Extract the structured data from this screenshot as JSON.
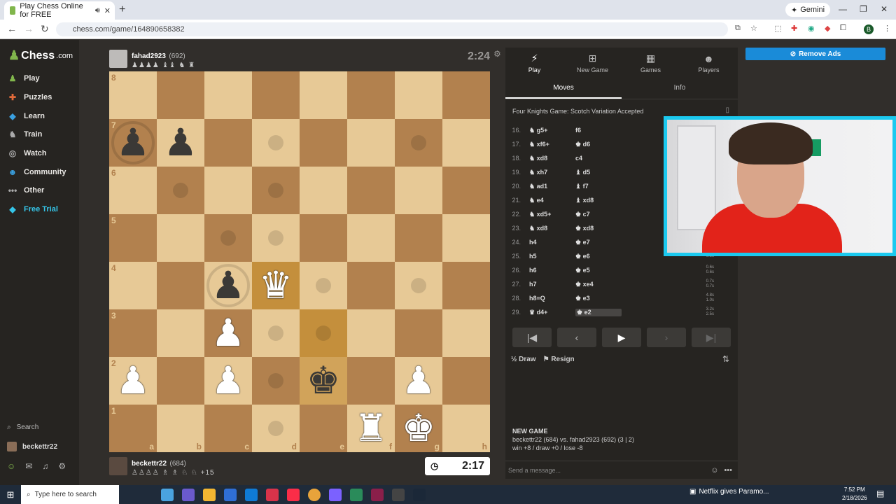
{
  "browser": {
    "tab_title": "Play Chess Online for FREE",
    "url": "chess.com/game/164890658382",
    "gemini_label": "Gemini",
    "profile_letter": "B"
  },
  "sidebar": {
    "logo": "Chess",
    "logo_suffix": ".com",
    "items": [
      {
        "label": "Play",
        "icon": "pawn-icon",
        "color": "#81b64c"
      },
      {
        "label": "Puzzles",
        "icon": "puzzle-icon",
        "color": "#e06a3a"
      },
      {
        "label": "Learn",
        "icon": "learn-icon",
        "color": "#3aa0e0"
      },
      {
        "label": "Train",
        "icon": "train-icon",
        "color": "#aaaaaa"
      },
      {
        "label": "Watch",
        "icon": "binoculars-icon",
        "color": "#aaaaaa"
      },
      {
        "label": "Community",
        "icon": "community-icon",
        "color": "#3aa0e0"
      },
      {
        "label": "Other",
        "icon": "more-icon",
        "color": "#aaaaaa"
      },
      {
        "label": "Free Trial",
        "icon": "diamond-icon",
        "color": "#35c5e8"
      }
    ],
    "search_label": "Search",
    "user_label": "beckettr22"
  },
  "top_player": {
    "name": "fahad2923",
    "rating": "(692)",
    "captured": "♟♟♟♟ ♝♝ ♞ ♜",
    "clock": "2:24"
  },
  "bottom_player": {
    "name": "beckettr22",
    "rating": "(684)",
    "captured": "♙♙♙♙ ♗ ♗ ♘ ♘",
    "advantage": "+15",
    "clock": "2:17"
  },
  "board": {
    "files": [
      "a",
      "b",
      "c",
      "d",
      "e",
      "f",
      "g",
      "h"
    ],
    "ranks": [
      "8",
      "7",
      "6",
      "5",
      "4",
      "3",
      "2",
      "1"
    ]
  },
  "panel": {
    "tabs": [
      {
        "label": "Play",
        "icon": "lightning-icon"
      },
      {
        "label": "New Game",
        "icon": "plus-icon"
      },
      {
        "label": "Games",
        "icon": "grid-icon"
      },
      {
        "label": "Players",
        "icon": "players-icon"
      }
    ],
    "subtabs": [
      "Moves",
      "Info"
    ],
    "opening": "Four Knights Game: Scotch Variation Accepted",
    "moves": [
      {
        "n": "16.",
        "w": "♞ g5+",
        "b": "f6",
        "t": [
          "",
          ""
        ]
      },
      {
        "n": "17.",
        "w": "♞ xf6+",
        "b": "♚ d6",
        "t": [
          "",
          ""
        ]
      },
      {
        "n": "18.",
        "w": "♞ xd8",
        "b": "c4",
        "t": [
          "",
          ""
        ]
      },
      {
        "n": "19.",
        "w": "♞ xh7",
        "b": "♝ d5",
        "t": [
          "",
          ""
        ]
      },
      {
        "n": "20.",
        "w": "♞ ad1",
        "b": "♝ f7",
        "t": [
          "",
          ""
        ]
      },
      {
        "n": "21.",
        "w": "♞ e4",
        "b": "♝ xd8",
        "t": [
          "",
          ""
        ]
      },
      {
        "n": "22.",
        "w": "♞ xd5+",
        "b": "♚ c7",
        "t": [
          "",
          ""
        ]
      },
      {
        "n": "23.",
        "w": "♞ xd8",
        "b": "♚ xd8",
        "t": [
          "",
          ""
        ]
      },
      {
        "n": "24.",
        "w": "h4",
        "b": "♚ e7",
        "t": [
          "",
          ""
        ]
      },
      {
        "n": "25.",
        "w": "h5",
        "b": "♚ e6",
        "t": [
          "0.8s",
          ""
        ]
      },
      {
        "n": "26.",
        "w": "h6",
        "b": "♚ e5",
        "t": [
          "0.6s",
          "0.6s"
        ]
      },
      {
        "n": "27.",
        "w": "h7",
        "b": "♚ xe4",
        "t": [
          "0.7s",
          "0.7s"
        ]
      },
      {
        "n": "28.",
        "w": "h8=Q",
        "b": "♚ e3",
        "t": [
          "4.8s",
          "1.0s"
        ]
      },
      {
        "n": "29.",
        "w": "♛ d4+",
        "b": "♚ e2",
        "t": [
          "3.2s",
          "2.5s"
        ]
      }
    ],
    "draw_label": "Draw",
    "resign_label": "Resign",
    "new_game_heading": "NEW GAME",
    "new_game_line": "beckettr22 (684) vs. fahad2923 (692) (3 | 2)",
    "new_game_result": "win +8 / draw +0 / lose -8",
    "message_placeholder": "Send a message..."
  },
  "remove_ads": "Remove Ads",
  "taskbar": {
    "search_placeholder": "Type here to search",
    "news": "Netflix gives Paramo...",
    "time": "7:52 PM",
    "date": "2/18/2026"
  },
  "colors": {
    "light_square": "#e7c996",
    "dark_square": "#b2814e",
    "accent_green": "#81b64c",
    "remove_ads_blue": "#1a8bd8",
    "webcam_border": "#1bc9ef"
  }
}
